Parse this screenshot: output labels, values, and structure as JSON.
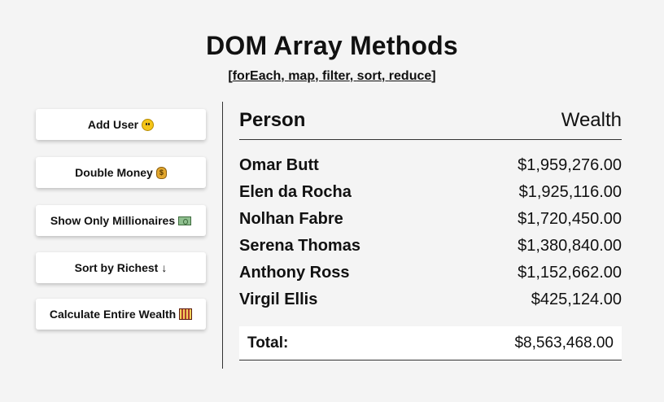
{
  "header": {
    "title": "DOM Array Methods",
    "subtitle_open": "[",
    "methods": [
      "forEach",
      "map",
      "filter",
      "sort",
      "reduce"
    ],
    "subtitle_close": "]"
  },
  "buttons": [
    {
      "label": "Add User",
      "icon": "smiley-face-icon"
    },
    {
      "label": "Double Money",
      "icon": "money-bag-icon"
    },
    {
      "label": "Show Only Millionaires",
      "icon": "dollar-bill-icon"
    },
    {
      "label": "Sort by Richest",
      "icon": "down-arrow-icon",
      "glyph": "↓"
    },
    {
      "label": "Calculate Entire Wealth",
      "icon": "abacus-icon"
    }
  ],
  "table": {
    "col_person": "Person",
    "col_wealth": "Wealth",
    "rows": [
      {
        "name": "Omar Butt",
        "wealth": "$1,959,276.00"
      },
      {
        "name": "Elen da Rocha",
        "wealth": "$1,925,116.00"
      },
      {
        "name": "Nolhan Fabre",
        "wealth": "$1,720,450.00"
      },
      {
        "name": "Serena Thomas",
        "wealth": "$1,380,840.00"
      },
      {
        "name": "Anthony Ross",
        "wealth": "$1,152,662.00"
      },
      {
        "name": "Virgil Ellis",
        "wealth": "$425,124.00"
      }
    ],
    "total_label": "Total:",
    "total_value": "$8,563,468.00"
  }
}
